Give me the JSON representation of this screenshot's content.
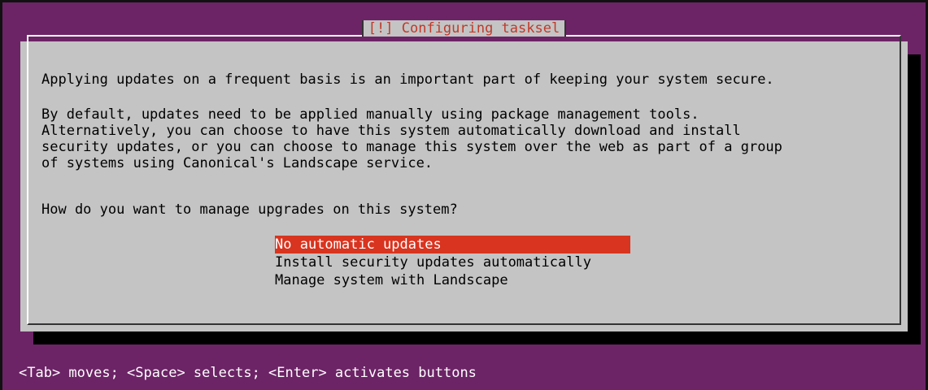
{
  "dialog": {
    "title": "[!] Configuring tasksel",
    "paragraph1": "Applying updates on a frequent basis is an important part of keeping your system secure.",
    "paragraph2": "By default, updates need to be applied manually using package management tools.\nAlternatively, you can choose to have this system automatically download and install\nsecurity updates, or you can choose to manage this system over the web as part of a group\nof systems using Canonical's Landscape service.",
    "question": "How do you want to manage upgrades on this system?",
    "options": [
      {
        "label": "No automatic updates",
        "selected": true
      },
      {
        "label": "Install security updates automatically",
        "selected": false
      },
      {
        "label": "Manage system with Landscape",
        "selected": false
      }
    ]
  },
  "footer": {
    "help": "<Tab> moves; <Space> selects; <Enter> activates buttons"
  },
  "colors": {
    "background": "#6c2466",
    "dialog": "#c4c4c4",
    "title_text": "#c0392b",
    "selected_bg": "#d8341f",
    "selected_text": "#ffffff"
  }
}
